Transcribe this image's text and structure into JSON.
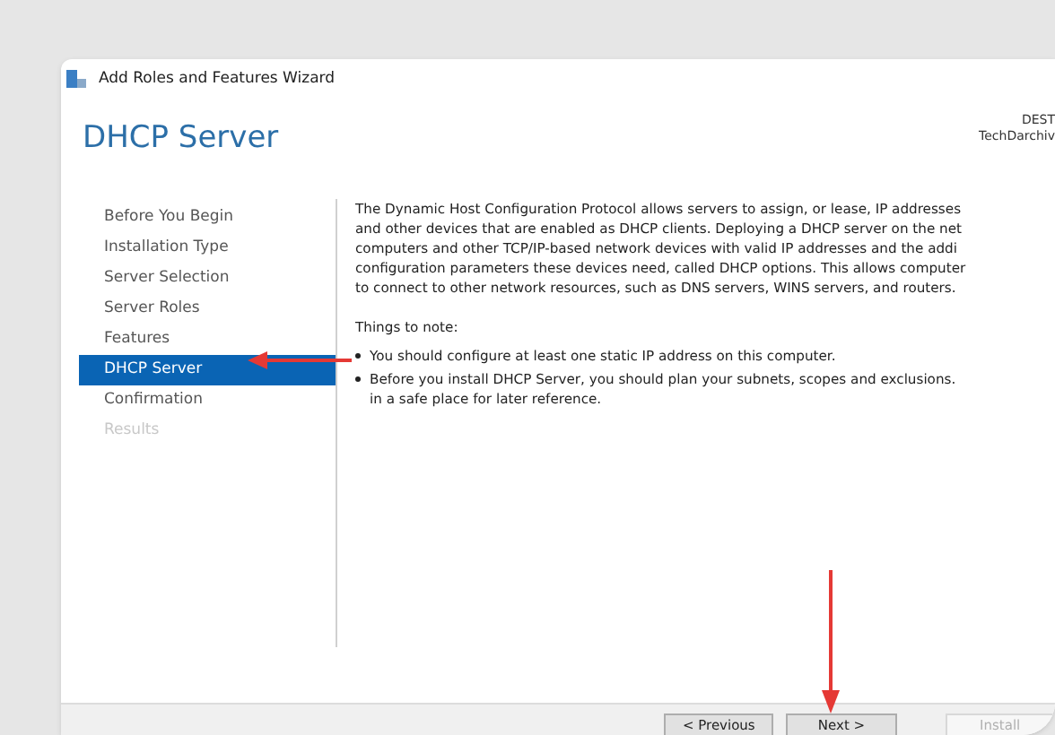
{
  "window": {
    "title": "Add Roles and Features Wizard"
  },
  "heading": "DHCP Server",
  "server_info": [
    "DEST",
    "TechDarchiv"
  ],
  "steps": [
    {
      "label": "Before You Begin",
      "selected": false,
      "disabled": false
    },
    {
      "label": "Installation Type",
      "selected": false,
      "disabled": false
    },
    {
      "label": "Server Selection",
      "selected": false,
      "disabled": false
    },
    {
      "label": "Server Roles",
      "selected": false,
      "disabled": false
    },
    {
      "label": "Features",
      "selected": false,
      "disabled": false
    },
    {
      "label": "DHCP Server",
      "selected": true,
      "disabled": false
    },
    {
      "label": "Confirmation",
      "selected": false,
      "disabled": false
    },
    {
      "label": "Results",
      "selected": false,
      "disabled": true
    }
  ],
  "description_lines": [
    "The Dynamic Host Configuration Protocol allows servers to assign, or lease, IP addresses",
    "and other devices that are enabled as DHCP clients. Deploying a DHCP server on the net",
    "computers and other TCP/IP-based network devices with valid IP addresses and the addi",
    "configuration parameters these devices need, called DHCP options. This allows computer",
    "to connect to other network resources, such as DNS servers, WINS servers, and routers."
  ],
  "notes_heading": "Things to note:",
  "notes": [
    [
      "You should configure at least one static IP address on this computer."
    ],
    [
      "Before you install DHCP Server, you should plan your subnets, scopes and exclusions.",
      "in a safe place for later reference."
    ]
  ],
  "buttons": [
    {
      "label": "< Previous",
      "disabled": false
    },
    {
      "label": "Next >",
      "disabled": false
    },
    {
      "label": "Install",
      "disabled": true
    }
  ]
}
